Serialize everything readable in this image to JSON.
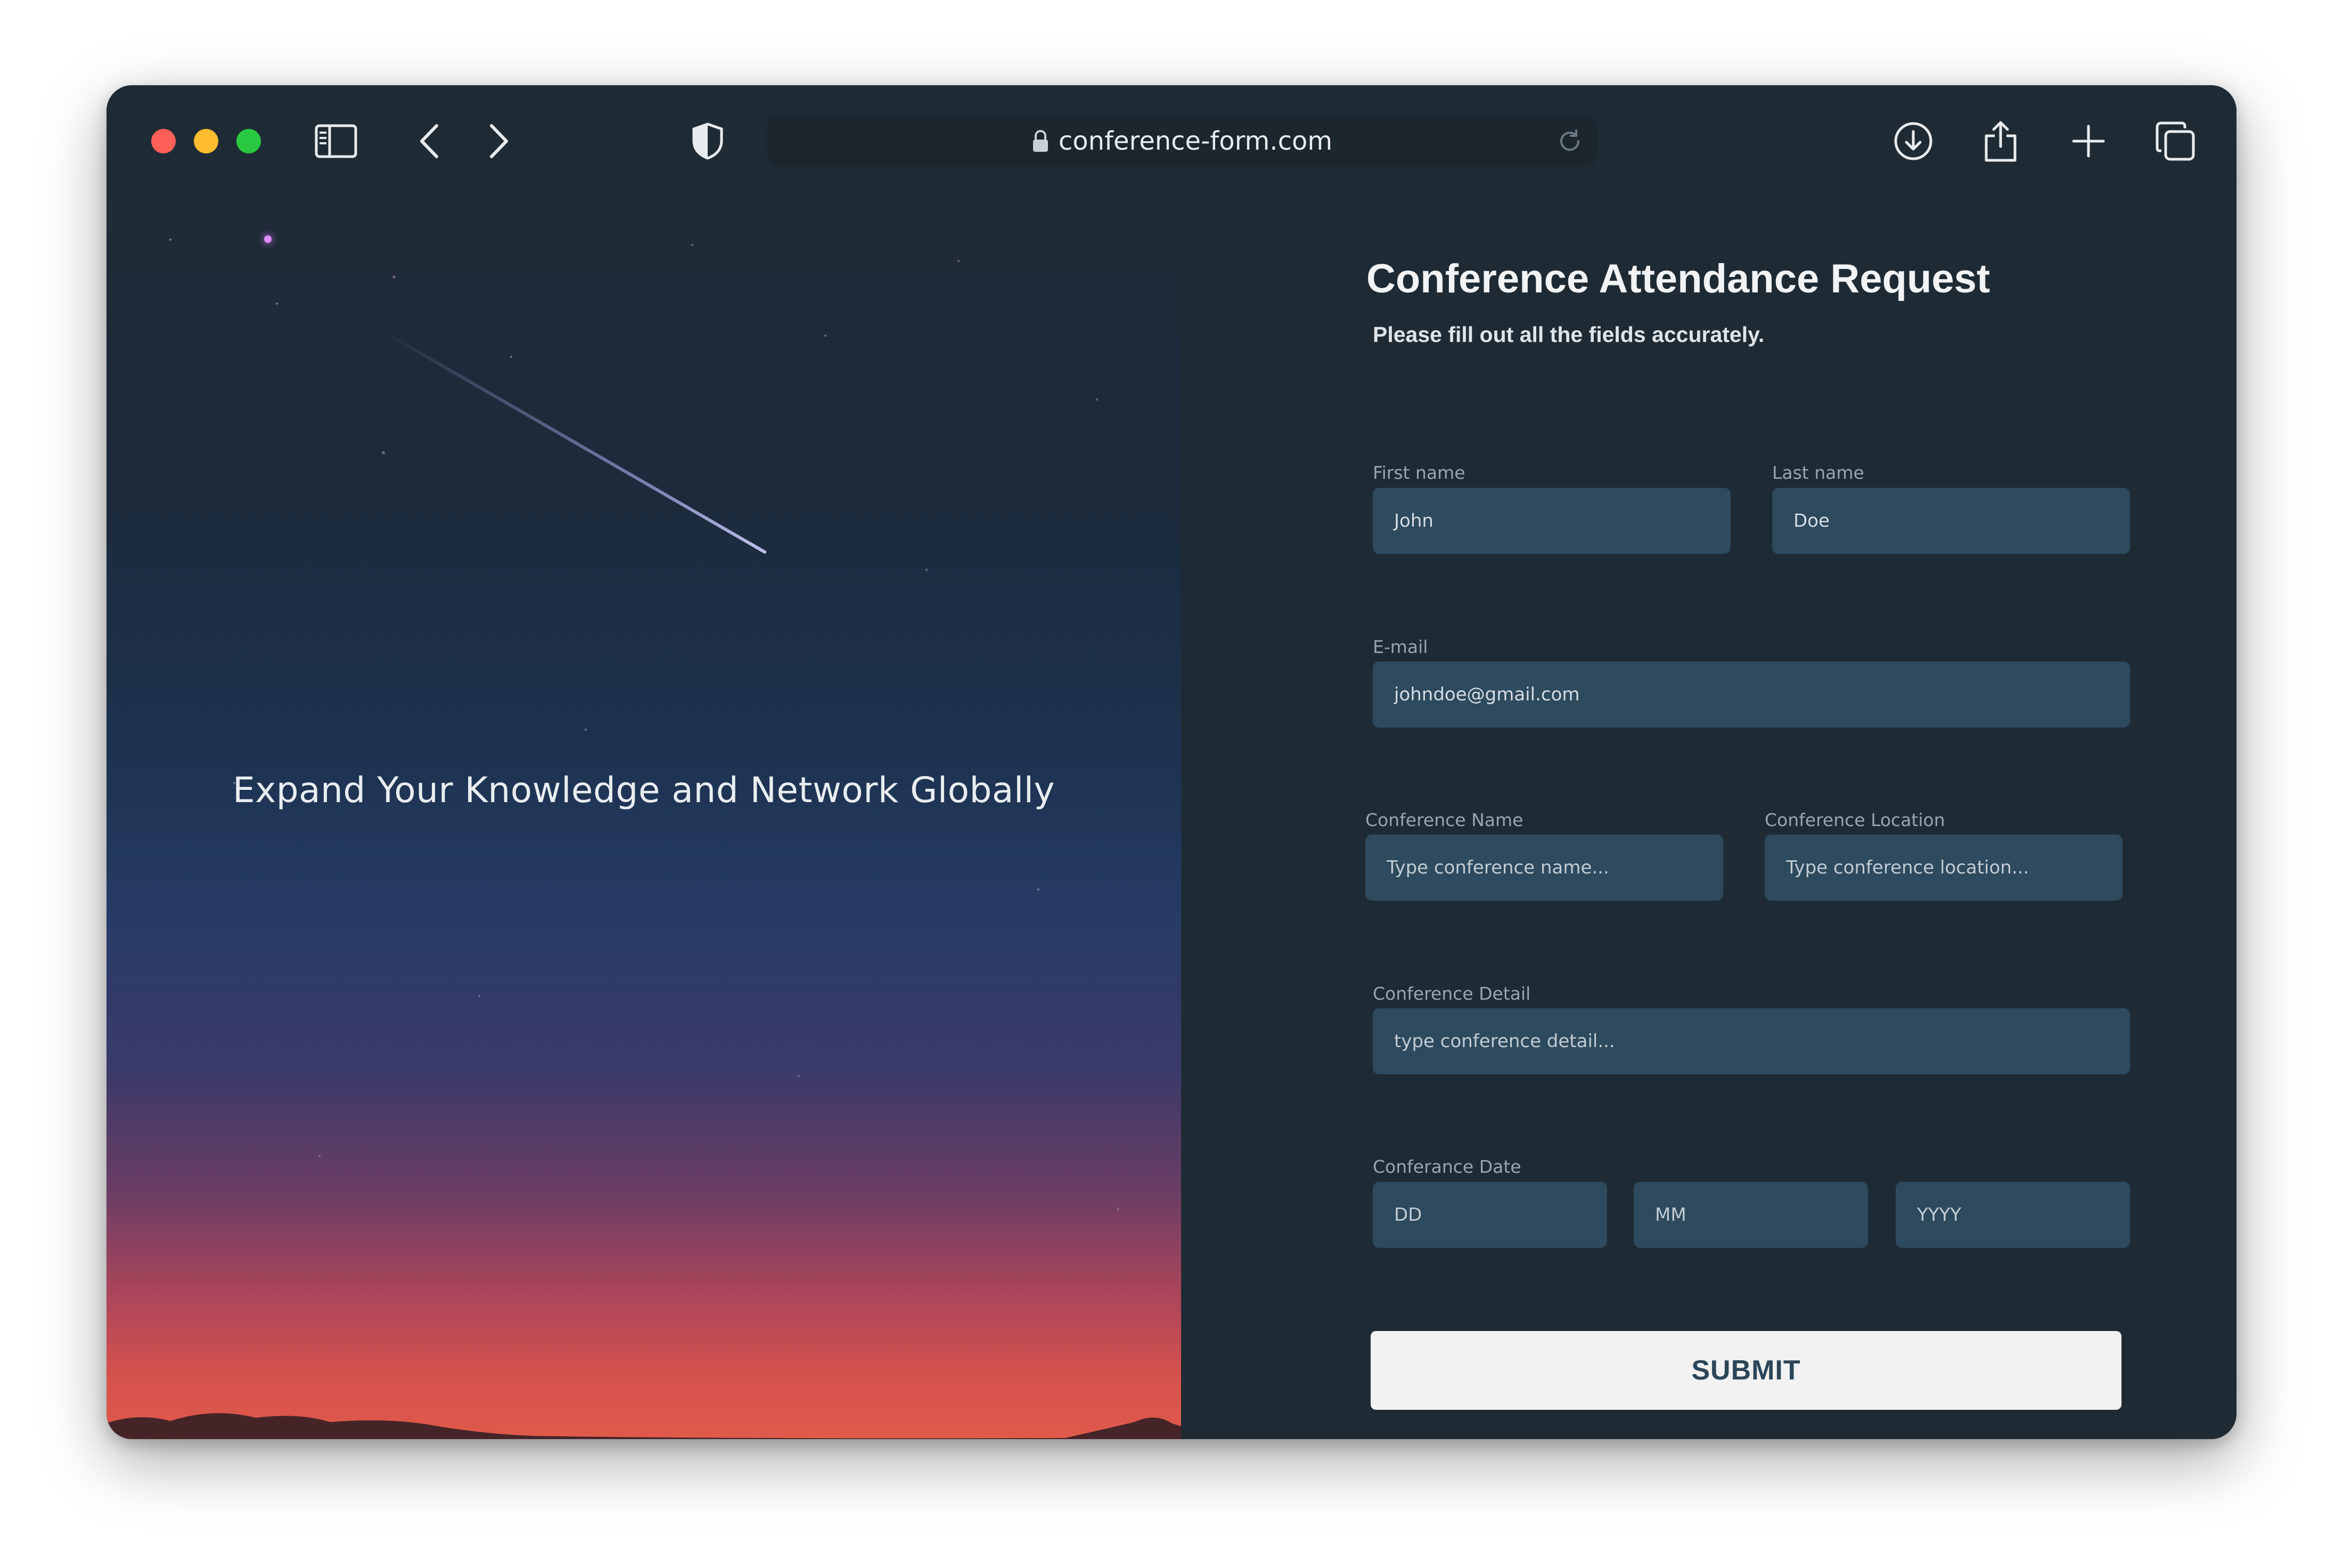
{
  "browser": {
    "url": "conference-form.com",
    "icons": [
      "sidebar-icon",
      "back-icon",
      "forward-icon",
      "shield-icon",
      "lock-icon",
      "reload-icon",
      "download-icon",
      "share-icon",
      "plus-icon",
      "tabs-icon"
    ]
  },
  "hero": {
    "tagline": "Expand Your Knowledge and Network Globally"
  },
  "form": {
    "title": "Conference Attendance Request",
    "subtitle": "Please fill out all the fields accurately.",
    "first_name": {
      "label": "First name",
      "value": "John"
    },
    "last_name": {
      "label": "Last name",
      "value": "Doe"
    },
    "email": {
      "label": "E-mail",
      "value": "johndoe@gmail.com"
    },
    "conference_name": {
      "label": "Conference Name",
      "placeholder": "Type conference name..."
    },
    "conference_location": {
      "label": "Conference Location",
      "placeholder": "Type conference location..."
    },
    "conference_detail": {
      "label": "Conference Detail",
      "placeholder": "type conference detail..."
    },
    "conference_date": {
      "label": "Conferance Date",
      "day": "DD",
      "month": "MM",
      "year": "YYYY"
    },
    "submit_label": "SUBMIT"
  },
  "colors": {
    "window_bg": "#1f2b34",
    "field_bg": "#2d4a5e",
    "submit_bg": "#f1f1f1",
    "submit_text": "#2b4658"
  }
}
